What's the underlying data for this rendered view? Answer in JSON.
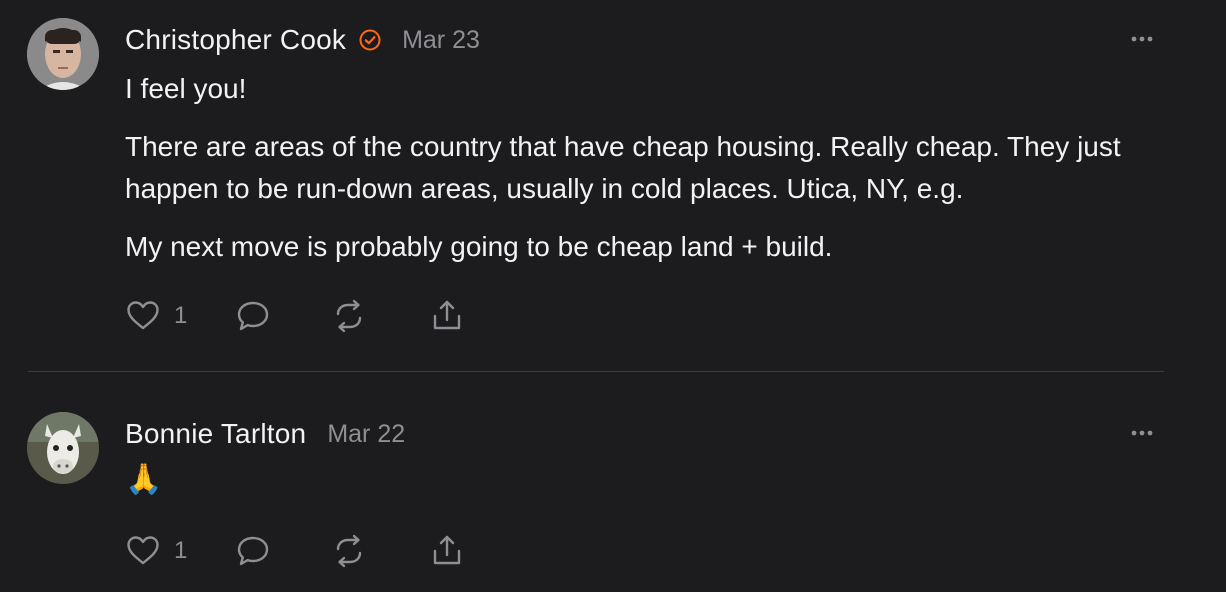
{
  "posts": [
    {
      "author": "Christopher Cook",
      "verified": true,
      "date": "Mar 23",
      "paragraphs": [
        "I feel you!",
        "There are areas of the country that have cheap housing. Really cheap. They just happen to be run-down areas, usually in cold places. Utica, NY, e.g.",
        "My next move is probably going to be cheap land + build."
      ],
      "like_count": "1",
      "icons": [
        "heart-icon",
        "comment-icon",
        "restack-icon",
        "share-icon",
        "more-icon",
        "verified-icon"
      ]
    },
    {
      "author": "Bonnie Tarlton",
      "verified": false,
      "date": "Mar 22",
      "paragraphs": [
        "🙏"
      ],
      "like_count": "1",
      "icons": [
        "heart-icon",
        "comment-icon",
        "restack-icon",
        "share-icon",
        "more-icon"
      ]
    }
  ],
  "colors": {
    "background": "#1c1c1e",
    "text": "#f2f2f2",
    "muted": "#8e8e93",
    "accent": "#ff6719",
    "divider": "#3a3a3c"
  }
}
